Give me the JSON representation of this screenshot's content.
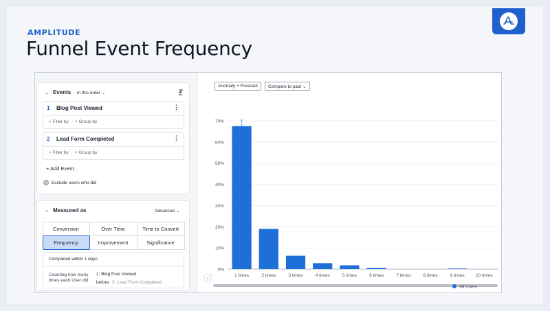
{
  "brand": "AMPLITUDE",
  "title": "Funnel Event Frequency",
  "left": {
    "events_label": "Events",
    "order": "in this order",
    "events": [
      {
        "num": "1",
        "name": "Blog Post Viewed",
        "filter": "+ Filter by",
        "group": "+ Group by"
      },
      {
        "num": "2",
        "name": "Lead Form Completed",
        "filter": "+ Filter by",
        "group": "+ Group by"
      }
    ],
    "add_event": "+ Add Event",
    "exclude": "Exclude users who did",
    "measured_label": "Measured as",
    "advanced": "Advanced",
    "tabs": [
      "Conversion",
      "Over Time",
      "Time to Convert",
      "Frequency",
      "Improvement",
      "Significance"
    ],
    "active_tab": "Frequency",
    "completed_within": "Completed within 1 days",
    "counting_label": "Counting how many times each User did",
    "counting_event": "1: Blog Post Viewed",
    "before_label": "before",
    "before_event": "2: Lead Form Completed"
  },
  "toolbar": {
    "anomaly": "Anomaly + Forecast",
    "compare": "Compare to past"
  },
  "colors": {
    "accent": "#1e61cd",
    "bar": "#1f6fd9"
  },
  "chart_data": {
    "type": "bar",
    "categories": [
      "1 times",
      "2 times",
      "3 times",
      "4 times",
      "5 times",
      "6 times",
      "7 times",
      "8 times",
      "9 times",
      "10 times"
    ],
    "series": [
      {
        "name": "All Users",
        "values": [
          67.5,
          19,
          6.3,
          2.8,
          1.8,
          0.6,
          0,
          0,
          0.3,
          0
        ]
      }
    ],
    "yticks": [
      "0%",
      "10%",
      "20%",
      "30%",
      "40%",
      "50%",
      "60%",
      "70%"
    ],
    "ylim": [
      0,
      70
    ],
    "grid": true,
    "legend": "bottom-right"
  }
}
